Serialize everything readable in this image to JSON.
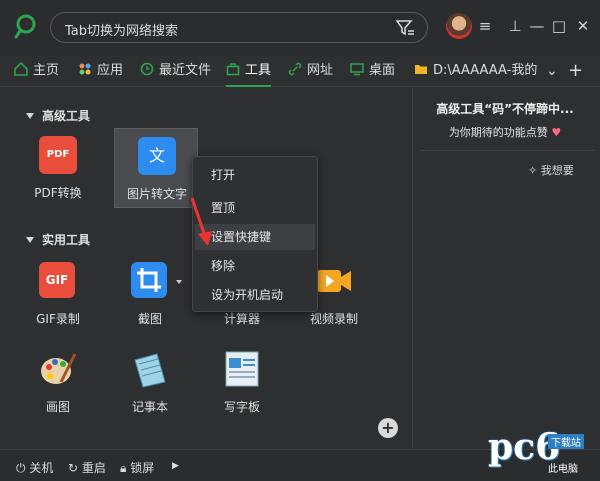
{
  "search": {
    "placeholder": "Tab切换为网络搜索"
  },
  "window_controls": {
    "menu": "≡",
    "pin": "⊥",
    "minimize": "—",
    "maximize": "□",
    "close": "✕"
  },
  "tabs": [
    {
      "label": "主页",
      "icon": "home-icon"
    },
    {
      "label": "应用",
      "icon": "apps-icon"
    },
    {
      "label": "最近文件",
      "icon": "clock-icon"
    },
    {
      "label": "工具",
      "icon": "toolbox-icon",
      "active": true
    },
    {
      "label": "网址",
      "icon": "link-icon"
    },
    {
      "label": "桌面",
      "icon": "monitor-icon"
    },
    {
      "label": "D:\\AAAAAA-我的",
      "icon": "folder-icon"
    }
  ],
  "tab_more": "⌄",
  "tab_add": "+",
  "sections": {
    "advanced": "高级工具",
    "practical": "实用工具"
  },
  "advanced_tools": [
    {
      "label": "PDF转换",
      "icon_text": "PDF"
    },
    {
      "label": "图片转文字",
      "icon_text": "文"
    }
  ],
  "practical_tools": [
    {
      "label": "GIF录制",
      "icon_text": "GIF"
    },
    {
      "label": "截图"
    },
    {
      "label": "计算器"
    },
    {
      "label": "视频录制"
    },
    {
      "label": "画图"
    },
    {
      "label": "记事本"
    },
    {
      "label": "写字板"
    }
  ],
  "promo": {
    "line1": "高级工具“码”不停蹄中...",
    "line2": "为你期待的功能点赞",
    "want": "我想要"
  },
  "context_menu": [
    "打开",
    "置顶",
    "设置快捷键",
    "移除",
    "设为开机启动"
  ],
  "bottom": {
    "shutdown": "关机",
    "restart": "重启",
    "lock": "锁屏"
  },
  "watermark": {
    "brand": "pc6",
    "tag1": "下载站",
    "tag2": "此电脑"
  },
  "colors": {
    "accent": "#2ea44f",
    "bg": "#2e2f30"
  }
}
